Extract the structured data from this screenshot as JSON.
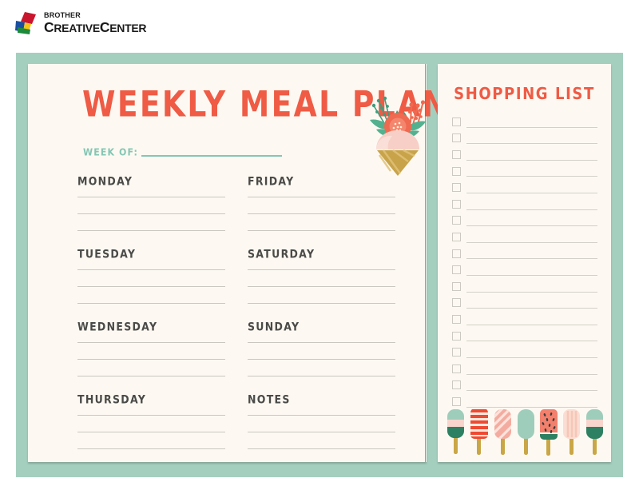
{
  "brand": {
    "line1": "BROTHER",
    "line2_part1": "C",
    "line2_part2": "REATIVE",
    "line2_part3": "C",
    "line2_part4": "ENTER",
    "logo_icon": "brother-diamond-logo-icon"
  },
  "meal_plan": {
    "title": "WEEKLY MEAL PLAN",
    "week_of_label": "WEEK OF:",
    "week_of_value": "",
    "lines_per_day": 3,
    "columns": [
      {
        "days": [
          {
            "label": "MONDAY",
            "entries": [
              "",
              "",
              ""
            ]
          },
          {
            "label": "TUESDAY",
            "entries": [
              "",
              "",
              ""
            ]
          },
          {
            "label": "WEDNESDAY",
            "entries": [
              "",
              "",
              ""
            ]
          },
          {
            "label": "THURSDAY",
            "entries": [
              "",
              "",
              ""
            ]
          }
        ]
      },
      {
        "days": [
          {
            "label": "FRIDAY",
            "entries": [
              "",
              "",
              ""
            ]
          },
          {
            "label": "SATURDAY",
            "entries": [
              "",
              "",
              ""
            ]
          },
          {
            "label": "SUNDAY",
            "entries": [
              "",
              "",
              ""
            ]
          },
          {
            "label": "NOTES",
            "entries": [
              "",
              "",
              ""
            ]
          }
        ]
      }
    ]
  },
  "shopping_list": {
    "title": "SHOPPING LIST",
    "item_count": 18,
    "items": [
      {
        "checked": false,
        "text": ""
      },
      {
        "checked": false,
        "text": ""
      },
      {
        "checked": false,
        "text": ""
      },
      {
        "checked": false,
        "text": ""
      },
      {
        "checked": false,
        "text": ""
      },
      {
        "checked": false,
        "text": ""
      },
      {
        "checked": false,
        "text": ""
      },
      {
        "checked": false,
        "text": ""
      },
      {
        "checked": false,
        "text": ""
      },
      {
        "checked": false,
        "text": ""
      },
      {
        "checked": false,
        "text": ""
      },
      {
        "checked": false,
        "text": ""
      },
      {
        "checked": false,
        "text": ""
      },
      {
        "checked": false,
        "text": ""
      },
      {
        "checked": false,
        "text": ""
      },
      {
        "checked": false,
        "text": ""
      },
      {
        "checked": false,
        "text": ""
      },
      {
        "checked": false,
        "text": ""
      }
    ]
  },
  "illustrations": {
    "cone": "floral-ice-cream-cone-illustration",
    "popsicles": [
      {
        "name": "layered-mint-pink-green-popsicle"
      },
      {
        "name": "red-striped-popsicle"
      },
      {
        "name": "pink-diagonal-stripe-popsicle"
      },
      {
        "name": "solid-mint-popsicle"
      },
      {
        "name": "watermelon-popsicle"
      },
      {
        "name": "pink-vertical-stripe-popsicle"
      },
      {
        "name": "layered-mint-pink-green-popsicle-2"
      }
    ]
  },
  "colors": {
    "frame_teal": "#a4cfbf",
    "paper_cream": "#fdf9f2",
    "accent_coral": "#ef5b45",
    "accent_mint": "#84c6b4",
    "text_dark": "#4a4a48",
    "rule_grey": "#c9c7c0",
    "page_background": "#ffffff"
  }
}
